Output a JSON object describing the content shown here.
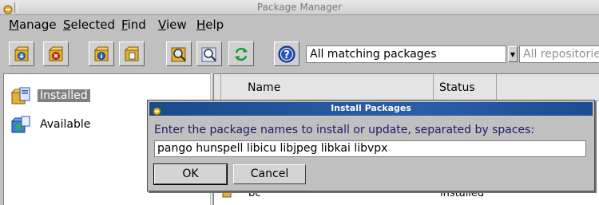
{
  "window": {
    "title": "Package Manager"
  },
  "menu": {
    "items": [
      {
        "label": "Manage",
        "accel": "M",
        "rest": "anage"
      },
      {
        "label": "Selected",
        "accel": "S",
        "rest": "elected"
      },
      {
        "label": "Find",
        "accel": "F",
        "rest": "ind"
      },
      {
        "label": "View",
        "accel": "V",
        "rest": "iew"
      },
      {
        "label": "Help",
        "accel": "H",
        "rest": "elp"
      }
    ]
  },
  "toolbar": {
    "icons": [
      "install-package-icon",
      "remove-package-icon",
      "package-info-icon",
      "package-files-icon",
      "find-icon",
      "find-next-icon",
      "refresh-icon",
      "help-icon"
    ],
    "filter": "All matching packages",
    "repository": "All repositories"
  },
  "sidebar": {
    "items": [
      {
        "label": "Installed",
        "selected": true
      },
      {
        "label": "Available",
        "selected": false
      }
    ]
  },
  "list": {
    "columns": [
      "Name",
      "Status"
    ],
    "rows": [
      {
        "name": "bc",
        "status": "installed"
      }
    ]
  },
  "dialog": {
    "title": "Install Packages",
    "prompt": "Enter the package names to install or update, separated by spaces:",
    "input_value": "pango hunspell libicu libjpeg libkai libvpx",
    "ok_label": "OK",
    "cancel_label": "Cancel"
  },
  "colors": {
    "dialog_title": "#2a5fa8",
    "selection": "#808080",
    "prompt_text": "#1a1a6a"
  }
}
